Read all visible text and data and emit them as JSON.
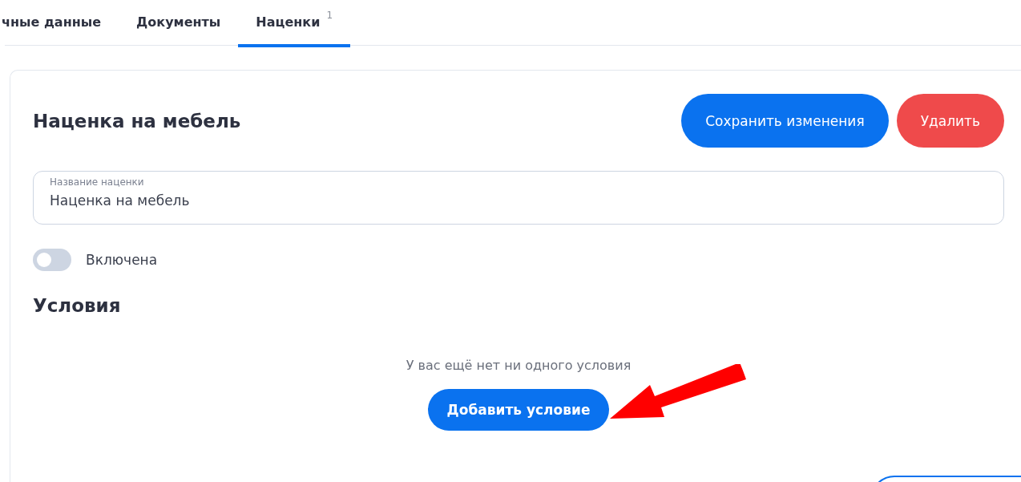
{
  "tabs": [
    {
      "label": "чные данные",
      "selected": false
    },
    {
      "label": "Документы",
      "selected": false
    },
    {
      "label": "Наценки",
      "badge": "1",
      "selected": true
    }
  ],
  "markup": {
    "title": "Наценка на мебель",
    "buttons": [
      {
        "label": "Сохранить изменения",
        "kind": "primary"
      },
      {
        "label": "Удалить",
        "kind": "danger"
      }
    ],
    "name_field": {
      "label": "Название наценки",
      "value": "Наценка на мебель"
    },
    "enabled": {
      "label": "Включена",
      "on": false
    },
    "conditions": {
      "title": "Условия",
      "empty_text": "У вас ещё нет ни одного условия",
      "add_button": "Добавить условие"
    }
  }
}
